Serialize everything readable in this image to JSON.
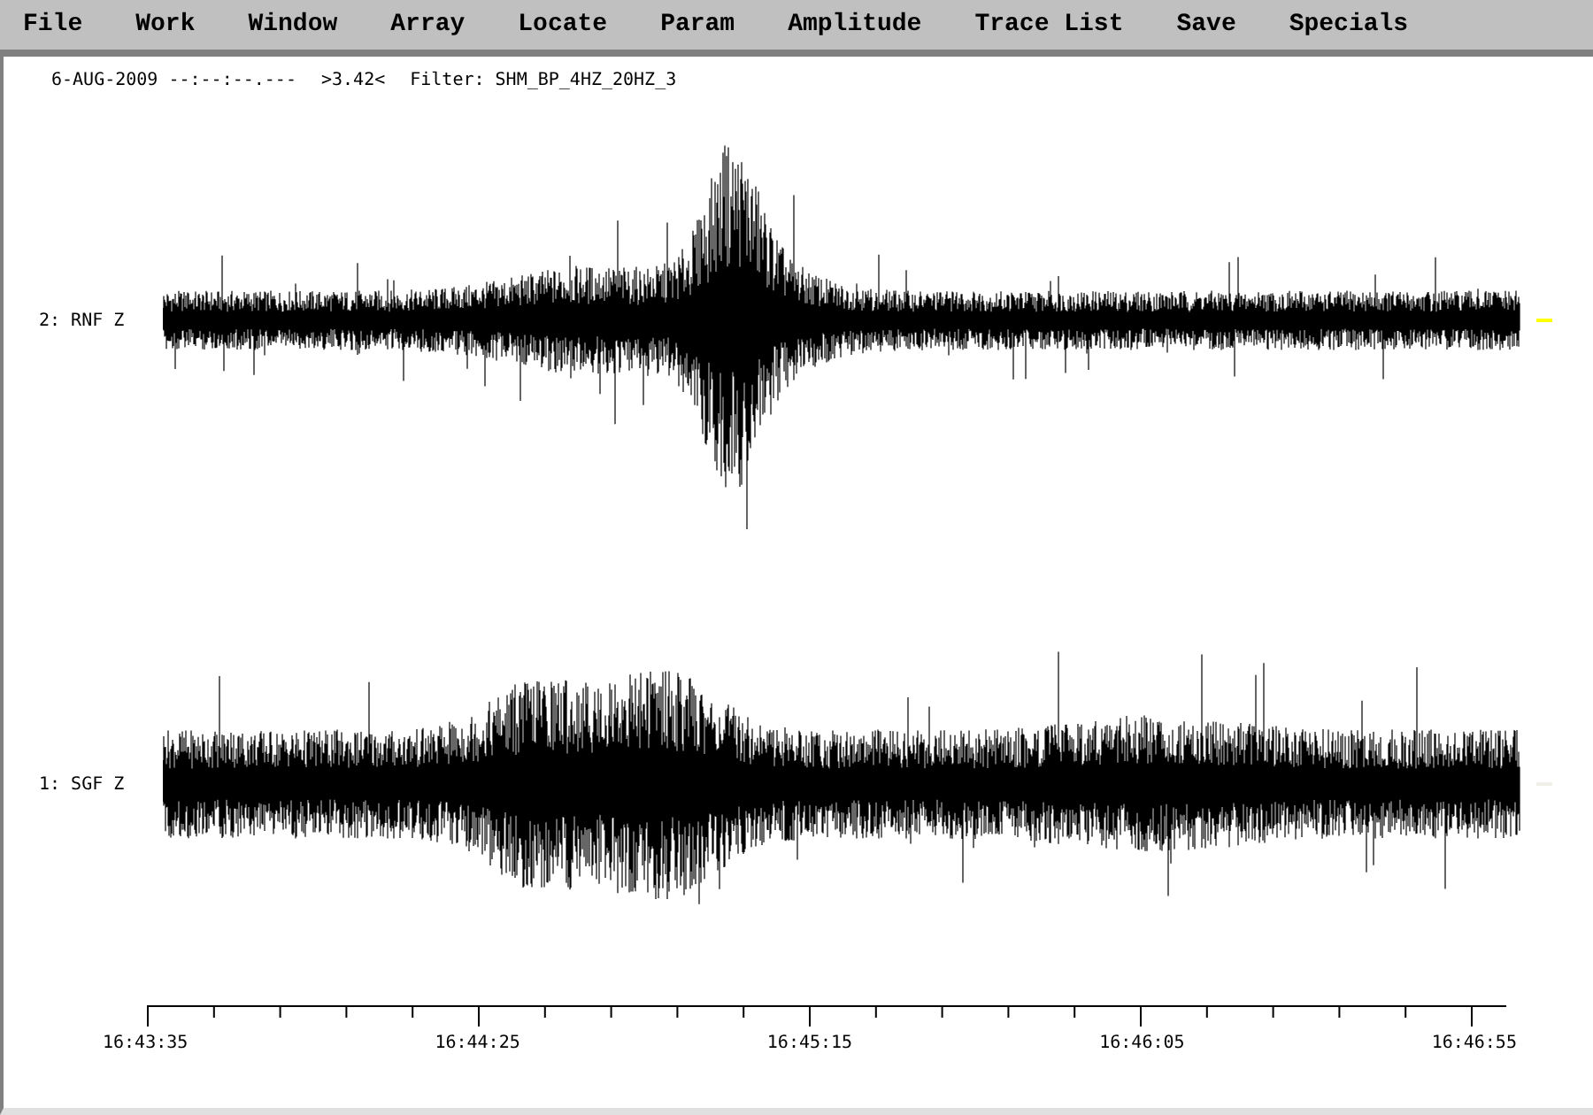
{
  "menu": [
    "File",
    "Work",
    "Window",
    "Array",
    "Locate",
    "Param",
    "Amplitude",
    "Trace List",
    "Save",
    "Specials"
  ],
  "header": {
    "date": "6-AUG-2009 --:--:--.---",
    "amplitude": ">3.42<",
    "filter": "Filter: SHM_BP_4HZ_20HZ_3"
  },
  "traces": [
    {
      "label": "2: RNF Z",
      "color": "#ffff00"
    },
    {
      "label": "1: SGF Z",
      "color": "#f0f0e8"
    }
  ],
  "time_axis": [
    "16:43:35",
    "16:44:25",
    "16:45:15",
    "16:46:05",
    "16:46:55"
  ]
}
